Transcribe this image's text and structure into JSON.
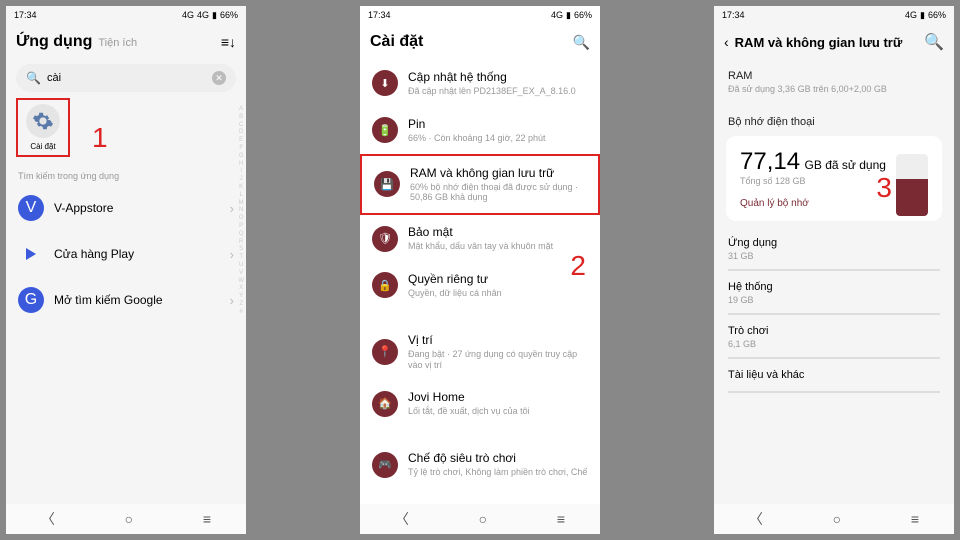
{
  "statusbar": {
    "time": "17:34",
    "battery": "66%",
    "net": "4G"
  },
  "screen1": {
    "title": "Ứng dụng",
    "subtitle": "Tiện ích",
    "search_value": "cài",
    "app_label": "Cài đặt",
    "hint": "Tìm kiếm trong ứng dụng",
    "items": [
      {
        "label": "V-Appstore"
      },
      {
        "label": "Cửa hàng Play"
      },
      {
        "label": "Mở tìm kiếm Google"
      }
    ],
    "callout": "1"
  },
  "screen2": {
    "title": "Cài đặt",
    "callout": "2",
    "items": [
      {
        "t": "Cập nhật hệ thống",
        "s": "Đã cập nhật lên PD2138EF_EX_A_8.16.0"
      },
      {
        "t": "Pin",
        "s": "66% · Còn khoảng 14 giờ, 22 phút"
      },
      {
        "t": "RAM và không gian lưu trữ",
        "s": "60% bộ nhớ điện thoại đã được sử dụng · 50,86 GB khả dụng"
      },
      {
        "t": "Bảo mật",
        "s": "Mật khẩu, dấu vân tay và khuôn mặt"
      },
      {
        "t": "Quyền riêng tư",
        "s": "Quyền, dữ liệu cá nhân"
      },
      {
        "t": "Vị trí",
        "s": "Đang bật · 27 ứng dụng có quyền truy cập vào vị trí"
      },
      {
        "t": "Jovi Home",
        "s": "Lối tắt, đề xuất, dịch vụ của tôi"
      },
      {
        "t": "Chế độ siêu trò chơi",
        "s": "Tỷ lệ trò chơi, Không làm phiền trò chơi, Chế"
      }
    ]
  },
  "screen3": {
    "title": "RAM và không gian lưu trữ",
    "callout": "3",
    "ram_title": "RAM",
    "ram_sub": "Đã sử dụng 3,36 GB trên 6,00+2,00 GB",
    "store_title": "Bộ nhớ điện thoại",
    "used_val": "77,14",
    "used_unit": "GB đã sử dụng",
    "total": "Tổng số 128 GB",
    "manage": "Quản lý bộ nhớ",
    "cats": [
      {
        "t": "Ứng dụng",
        "v": "31 GB"
      },
      {
        "t": "Hệ thống",
        "v": "19 GB"
      },
      {
        "t": "Trò chơi",
        "v": "6,1 GB"
      },
      {
        "t": "Tài liệu và khác",
        "v": ""
      }
    ]
  },
  "chart_data": {
    "type": "bar",
    "title": "Bộ nhớ điện thoại",
    "categories": [
      "Đã sử dụng"
    ],
    "values": [
      77.14
    ],
    "ylim": [
      0,
      128
    ],
    "ylabel": "GB"
  }
}
